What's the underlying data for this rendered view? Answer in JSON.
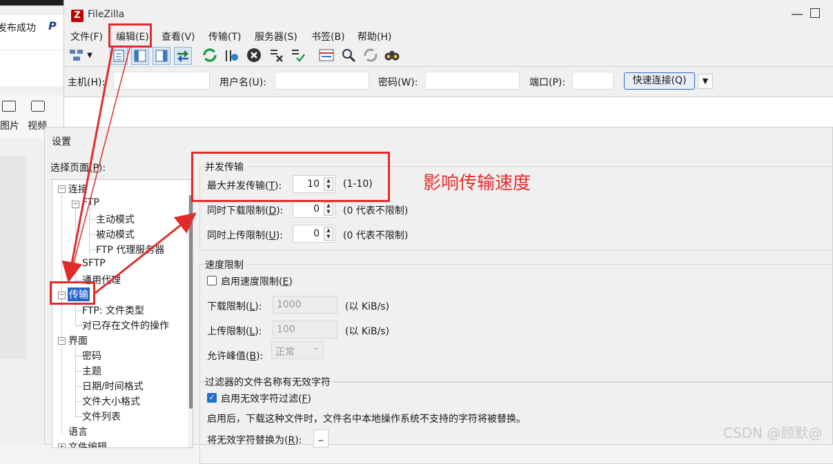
{
  "bg_app": {
    "publish_label": "发布成功",
    "image_label": "图片",
    "video_label": "视频"
  },
  "window": {
    "title": "FileZilla",
    "logo": "Z"
  },
  "menu": [
    "文件(F)",
    "编辑(E)",
    "查看(V)",
    "传输(T)",
    "服务器(S)",
    "书签(B)",
    "帮助(H)"
  ],
  "quickconnect": {
    "host_label": "主机(H):",
    "user_label": "用户名(U):",
    "pass_label": "密码(W):",
    "port_label": "端口(P):",
    "host": "",
    "user": "",
    "pass": "",
    "port": "",
    "button": "快速连接(Q)"
  },
  "dialog": {
    "title": "设置",
    "select_page_label": "选择页面(P):"
  },
  "tree": [
    {
      "label": "连接",
      "toggle": "−"
    },
    {
      "label": "FTP",
      "toggle": "−"
    },
    {
      "label": "主动模式"
    },
    {
      "label": "被动模式"
    },
    {
      "label": "FTP 代理服务器"
    },
    {
      "label": "SFTP"
    },
    {
      "label": "通用代理"
    },
    {
      "label": "传输",
      "toggle": "−",
      "selected": true
    },
    {
      "label": "FTP: 文件类型"
    },
    {
      "label": "对已存在文件的操作"
    },
    {
      "label": "界面",
      "toggle": "−"
    },
    {
      "label": "密码"
    },
    {
      "label": "主题"
    },
    {
      "label": "日期/时间格式"
    },
    {
      "label": "文件大小格式"
    },
    {
      "label": "文件列表"
    },
    {
      "label": "语言"
    },
    {
      "label": "文件编辑",
      "toggle": "+"
    }
  ],
  "concurrent": {
    "title": "并发传输",
    "max_label": "最大并发传输(T):",
    "max_value": "10",
    "max_hint": "(1-10)",
    "down_label": "同时下载限制(D):",
    "down_value": "0",
    "down_hint": "(0 代表不限制)",
    "up_label": "同时上传限制(U):",
    "up_value": "0",
    "up_hint": "(0 代表不限制)"
  },
  "speed": {
    "title": "速度限制",
    "enable_label": "启用速度限制(E)",
    "enabled": false,
    "down_label": "下载限制(L):",
    "down_value": "1000",
    "down_unit": "(以 KiB/s)",
    "up_label": "上传限制(L):",
    "up_value": "100",
    "up_unit": "(以 KiB/s)",
    "burst_label": "允许峰值(B):",
    "burst_value": "正常"
  },
  "filter": {
    "title": "过滤器的文件名称有无效字符",
    "enable_label": "启用无效字符过滤(F)",
    "enabled": true,
    "desc": "启用后，下载这种文件时，文件名中本地操作系统不支持的字符将被替换。",
    "replace_label": "将无效字符替换为(R):",
    "replace_value": "_"
  },
  "annotation": {
    "text": "影响传输速度",
    "color": "#e62e2e"
  },
  "watermark": "CSDN @顾默@"
}
